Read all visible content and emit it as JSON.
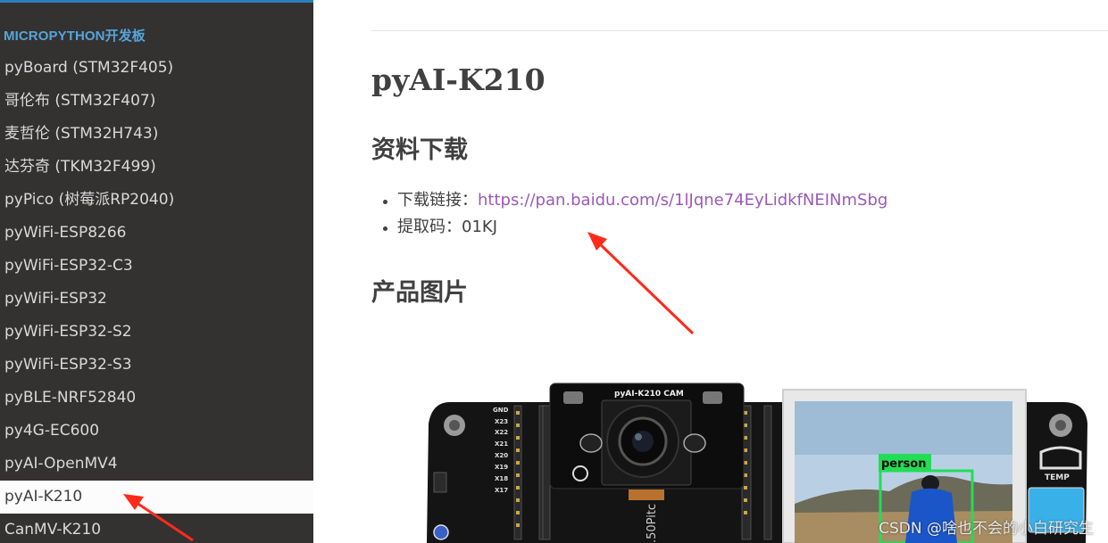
{
  "sidebar": {
    "caption": "MICROPYTHON开发板",
    "items": [
      {
        "label": "pyBoard (STM32F405)"
      },
      {
        "label": "哥伦布 (STM32F407)"
      },
      {
        "label": "麦哲伦 (STM32H743)"
      },
      {
        "label": "达芬奇 (TKM32F499)"
      },
      {
        "label": "pyPico (树莓派RP2040)"
      },
      {
        "label": "pyWiFi-ESP8266"
      },
      {
        "label": "pyWiFi-ESP32-C3"
      },
      {
        "label": "pyWiFi-ESP32"
      },
      {
        "label": "pyWiFi-ESP32-S2"
      },
      {
        "label": "pyWiFi-ESP32-S3"
      },
      {
        "label": "pyBLE-NRF52840"
      },
      {
        "label": "py4G-EC600"
      },
      {
        "label": "pyAI-OpenMV4"
      },
      {
        "label": "pyAI-K210",
        "active": true
      },
      {
        "label": "CanMV-K210"
      }
    ]
  },
  "main": {
    "title": "pyAI-K210",
    "download": {
      "heading": "资料下载",
      "link_label": "下载链接：",
      "link_url": "https://pan.baidu.com/s/1lJqne74EyLidkfNEINmSbg",
      "code_label": "提取码：01KJ"
    },
    "pictures": {
      "heading": "产品图片",
      "board_label": "pyAI-K210 CAM",
      "detection_label": "person",
      "silk_label": "TEMP",
      "pitch_label": ".50Pitc",
      "pin_labels": [
        "GND",
        "X23",
        "X22",
        "X21",
        "X20",
        "X19",
        "X18",
        "X17"
      ]
    },
    "watermark": "CSDN @啥也不会的小白研究生"
  },
  "colors": {
    "sidebar_bg": "#343131",
    "caption": "#55a5d9",
    "link": "#9b59b6",
    "arrow": "#ff2a1a",
    "detection_box": "#22dd55"
  }
}
